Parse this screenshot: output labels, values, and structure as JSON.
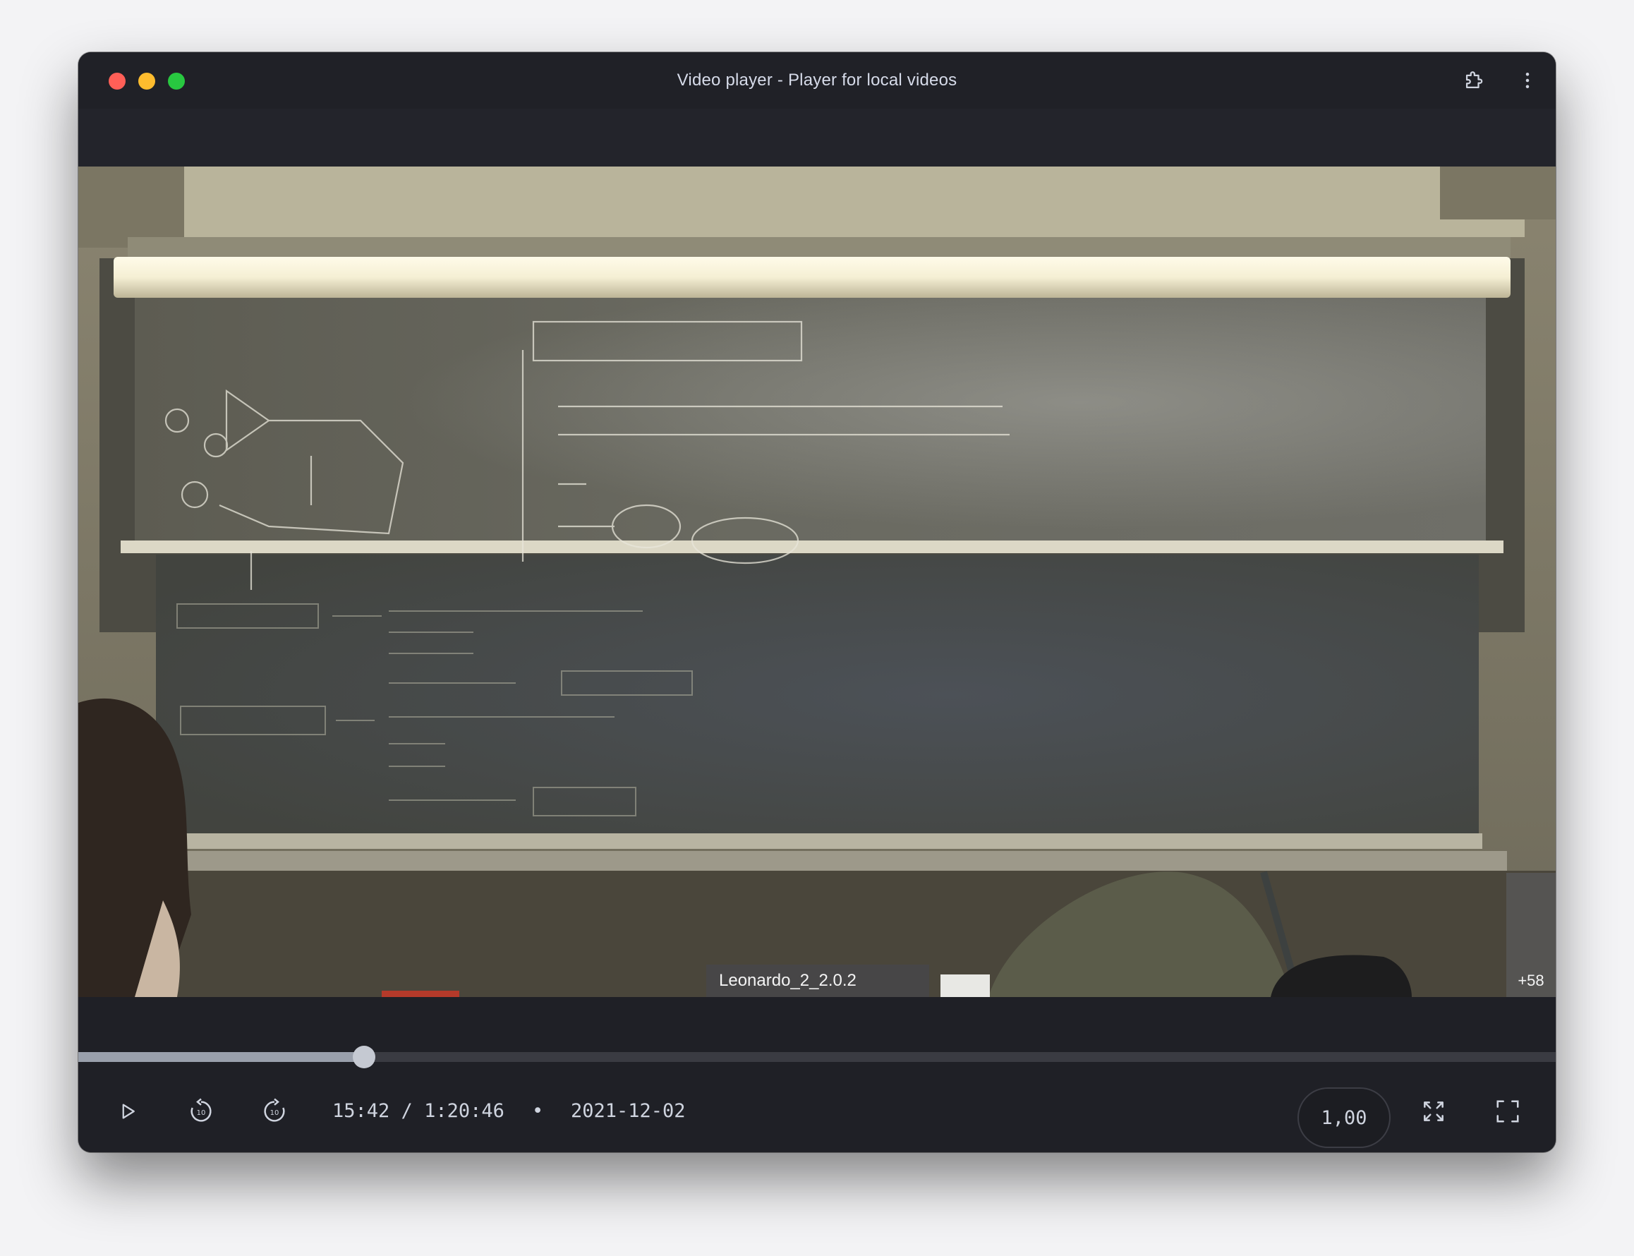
{
  "window": {
    "title": "Video player - Player for local videos"
  },
  "video": {
    "participant_label": "Leonardo_2_2.0.2",
    "extra_participants": "+58"
  },
  "playback": {
    "progress": 0.1934,
    "current_time": "15:42",
    "separator": "/",
    "duration": "1:20:46",
    "dot": "•",
    "date": "2021-12-02",
    "speed": "1,00"
  },
  "icons": {
    "close": "close-dot",
    "minimize": "minimize-dot",
    "zoom": "zoom-dot",
    "extension": "puzzle-icon",
    "more": "more-vertical-icon",
    "play": "play-icon",
    "rewind": "rewind-10-icon",
    "forward": "forward-10-icon",
    "expand": "expand-icon",
    "fullscreen": "fullscreen-icon"
  },
  "colors": {
    "window_bg": "#202127",
    "accent_progress": "#9aa0ac",
    "traffic_red": "#ff5f57",
    "traffic_yellow": "#febc2e",
    "traffic_green": "#28c840"
  }
}
